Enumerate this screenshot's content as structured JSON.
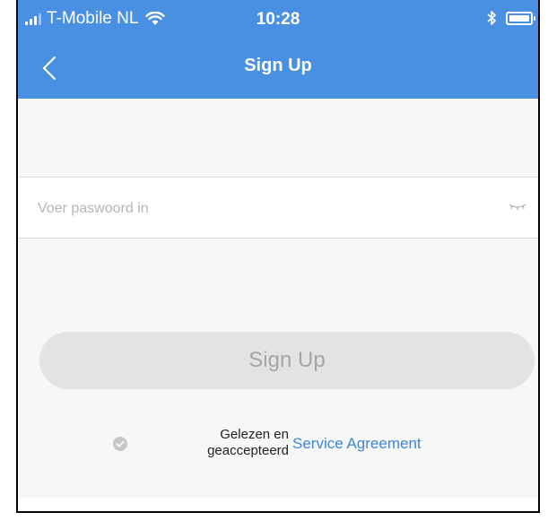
{
  "status_bar": {
    "carrier": "T-Mobile NL",
    "time": "10:28",
    "icons": [
      "signal-icon",
      "wifi-icon",
      "bluetooth-icon",
      "battery-icon"
    ]
  },
  "nav": {
    "title": "Sign Up",
    "back_icon": "chevron-left-icon"
  },
  "form": {
    "password_placeholder": "Voer paswoord in",
    "password_value": "",
    "visibility_icon": "eye-closed-icon"
  },
  "signup_button": {
    "label": "Sign Up"
  },
  "agreement": {
    "text_line1": "Gelezen en",
    "text_line2": "geaccepteerd",
    "link": "Service Agreement",
    "checked": false
  },
  "colors": {
    "header": "#4a90e2",
    "link": "#3b86d9",
    "button_disabled": "#e3e3e3",
    "background": "#f7f7f7"
  }
}
